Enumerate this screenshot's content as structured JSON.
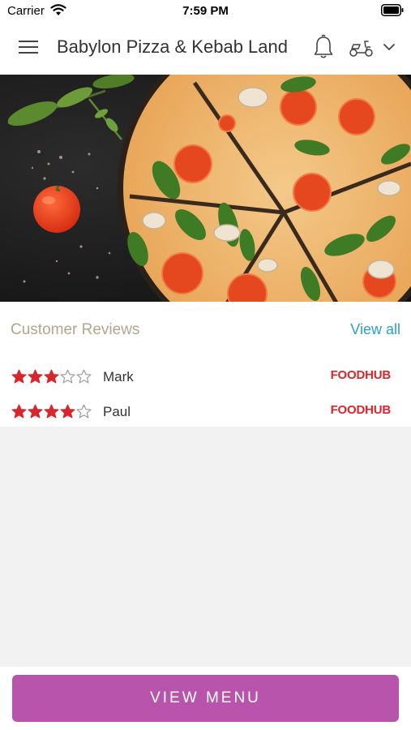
{
  "status_bar": {
    "carrier": "Carrier",
    "time": "7:59 PM"
  },
  "header": {
    "title": "Babylon Pizza & Kebab Land"
  },
  "reviews": {
    "title": "Customer Reviews",
    "view_all": "View all",
    "items": [
      {
        "rating": 3,
        "max": 5,
        "name": "Mark",
        "source": "FOODHUB"
      },
      {
        "rating": 4,
        "max": 5,
        "name": "Paul",
        "source": "FOODHUB"
      }
    ]
  },
  "footer": {
    "button_label": "VIEW MENU"
  },
  "colors": {
    "accent": "#b954ac",
    "link": "#2d9fc9",
    "reviews_title": "#b3a68d",
    "star": "#d7262c",
    "brand": "#d7262c"
  }
}
